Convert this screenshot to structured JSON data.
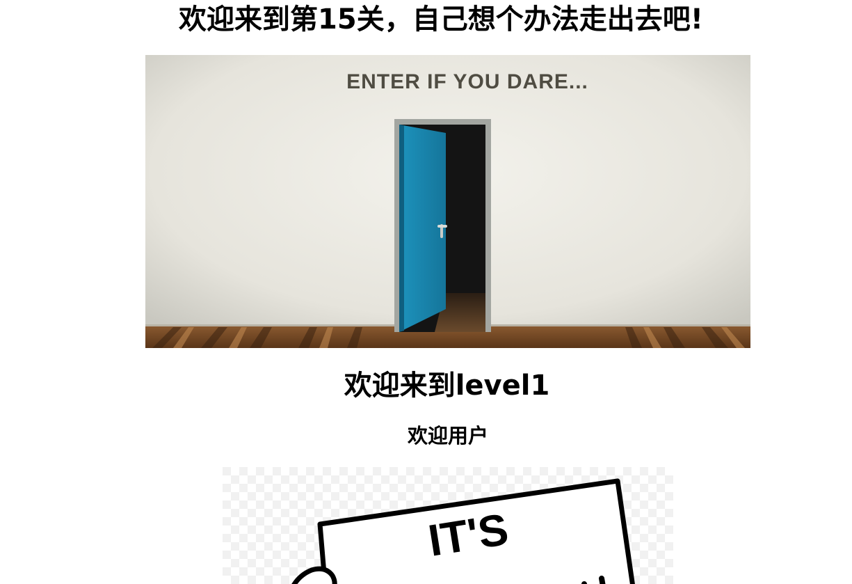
{
  "page": {
    "title": "欢迎来到第15关，自己想个办法走出去吧!",
    "heading": "欢迎来到level1",
    "subheading": "欢迎用户"
  },
  "banner": {
    "sign_text": "ENTER IF YOU DARE...",
    "colors": {
      "wall": "#eceae2",
      "door": "#1b8bb5",
      "door_frame": "#9a9d98",
      "doorway": "#151515",
      "floor": "#7a4d2a"
    }
  },
  "meme": {
    "sign_text": "IT'S"
  }
}
